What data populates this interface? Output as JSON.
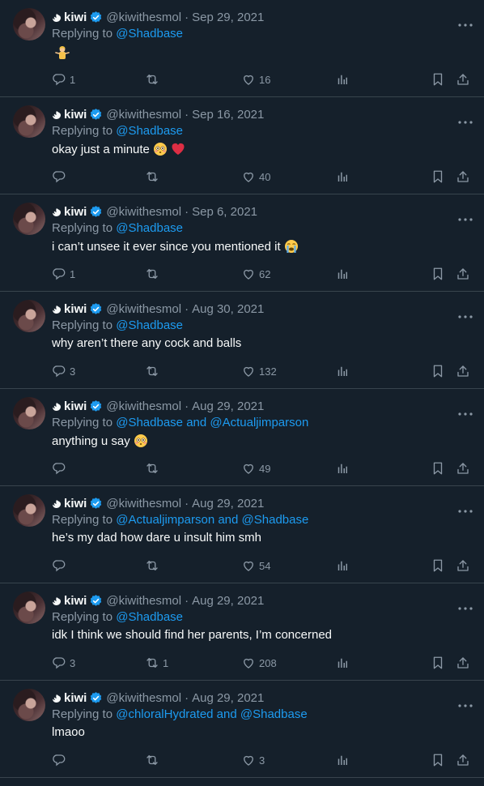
{
  "colors": {
    "background": "#15202b",
    "accent": "#1d9bf0",
    "muted": "#8b98a5",
    "divider": "#38444d"
  },
  "replying_prefix": "Replying to",
  "tweets": [
    {
      "name": "kiwi",
      "handle": "@kiwithesmol",
      "sep": "·",
      "date": "Sep 29, 2021",
      "mentions": [
        "@Shadbase"
      ],
      "mention_joiner": "",
      "text": "",
      "emoji": [
        "person-shrugging"
      ],
      "replies": "1",
      "retweets": "",
      "likes": "16"
    },
    {
      "name": "kiwi",
      "handle": "@kiwithesmol",
      "sep": "·",
      "date": "Sep 16, 2021",
      "mentions": [
        "@Shadbase"
      ],
      "mention_joiner": "",
      "text": "okay just a minute",
      "emoji": [
        "flushed-face",
        "red-heart"
      ],
      "replies": "",
      "retweets": "",
      "likes": "40"
    },
    {
      "name": "kiwi",
      "handle": "@kiwithesmol",
      "sep": "·",
      "date": "Sep 6, 2021",
      "mentions": [
        "@Shadbase"
      ],
      "mention_joiner": "",
      "text": "i can’t unsee it ever since you mentioned it",
      "emoji": [
        "loudly-crying-face"
      ],
      "replies": "1",
      "retweets": "",
      "likes": "62"
    },
    {
      "name": "kiwi",
      "handle": "@kiwithesmol",
      "sep": "·",
      "date": "Aug 30, 2021",
      "mentions": [
        "@Shadbase"
      ],
      "mention_joiner": "",
      "text": "why aren’t there any cock and balls",
      "emoji": [],
      "replies": "3",
      "retweets": "",
      "likes": "132"
    },
    {
      "name": "kiwi",
      "handle": "@kiwithesmol",
      "sep": "·",
      "date": "Aug 29, 2021",
      "mentions": [
        "@Shadbase",
        "@Actualjimparson"
      ],
      "mention_joiner": "and",
      "text": "anything u say",
      "emoji": [
        "flushed-face"
      ],
      "replies": "",
      "retweets": "",
      "likes": "49"
    },
    {
      "name": "kiwi",
      "handle": "@kiwithesmol",
      "sep": "·",
      "date": "Aug 29, 2021",
      "mentions": [
        "@Actualjimparson",
        "@Shadbase"
      ],
      "mention_joiner": "and",
      "text": "he’s my dad how dare u insult him smh",
      "emoji": [],
      "replies": "",
      "retweets": "",
      "likes": "54"
    },
    {
      "name": "kiwi",
      "handle": "@kiwithesmol",
      "sep": "·",
      "date": "Aug 29, 2021",
      "mentions": [
        "@Shadbase"
      ],
      "mention_joiner": "",
      "text": "idk I think we should find her parents, I’m concerned",
      "emoji": [],
      "replies": "3",
      "retweets": "1",
      "likes": "208"
    },
    {
      "name": "kiwi",
      "handle": "@kiwithesmol",
      "sep": "·",
      "date": "Aug 29, 2021",
      "mentions": [
        "@chloralHydrated",
        "@Shadbase"
      ],
      "mention_joiner": "and",
      "text": "lmaoo",
      "emoji": [],
      "replies": "",
      "retweets": "",
      "likes": "3"
    }
  ]
}
